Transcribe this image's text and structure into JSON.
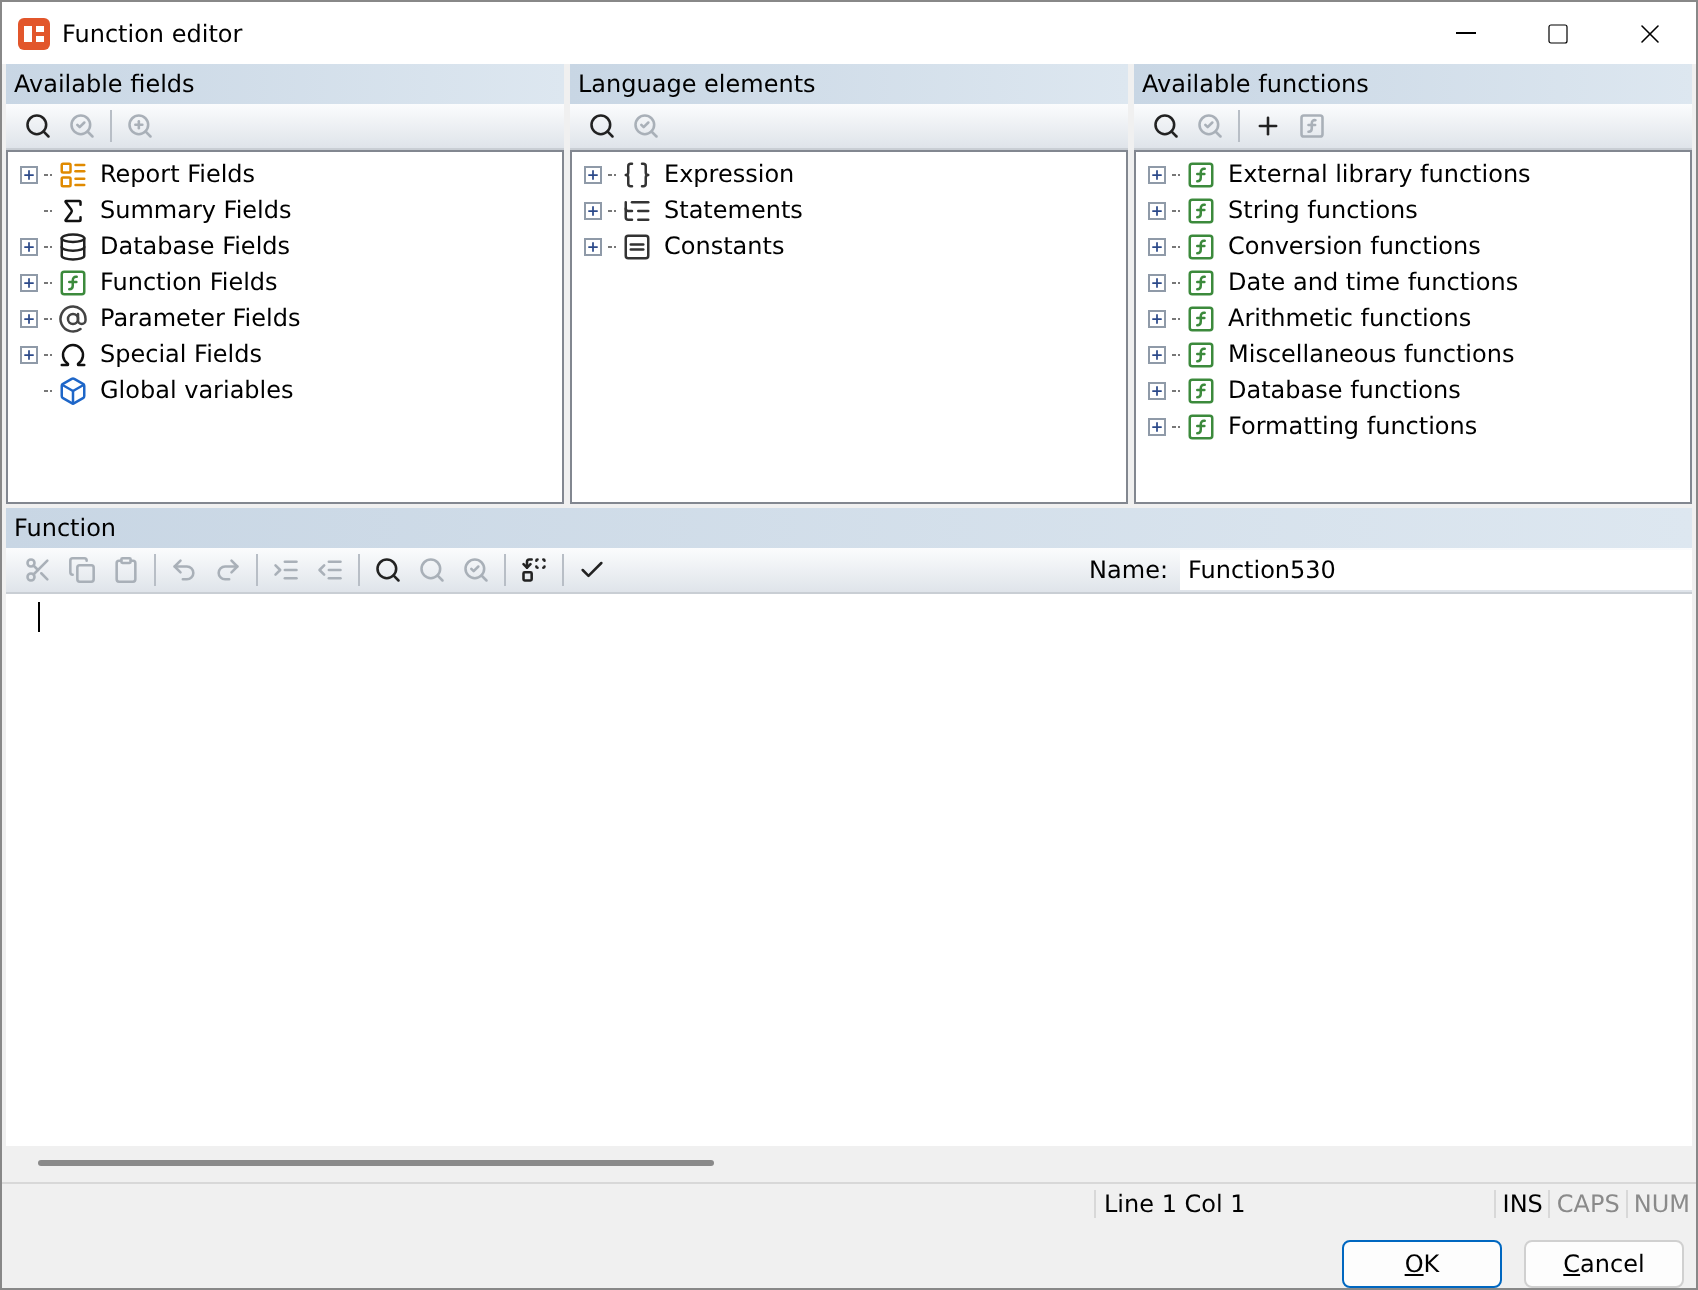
{
  "window": {
    "title": "Function editor"
  },
  "panels": [
    {
      "title": "Available fields",
      "tools": [
        {
          "kind": "search",
          "disabled": false
        },
        {
          "kind": "search-next",
          "disabled": true
        },
        {
          "kind": "sep"
        },
        {
          "kind": "zoom",
          "disabled": true
        }
      ],
      "items": [
        {
          "label": "Report Fields",
          "kind": "report",
          "expandable": true
        },
        {
          "label": "Summary Fields",
          "kind": "sum",
          "expandable": false
        },
        {
          "label": "Database Fields",
          "kind": "database",
          "expandable": true
        },
        {
          "label": "Function Fields",
          "kind": "function",
          "expandable": true
        },
        {
          "label": "Parameter Fields",
          "kind": "parameter",
          "expandable": true
        },
        {
          "label": "Special Fields",
          "kind": "special",
          "expandable": true
        },
        {
          "label": "Global variables",
          "kind": "global",
          "expandable": false
        }
      ]
    },
    {
      "title": "Language elements",
      "tools": [
        {
          "kind": "search",
          "disabled": false
        },
        {
          "kind": "search-next",
          "disabled": true
        }
      ],
      "items": [
        {
          "label": "Expression",
          "kind": "expression",
          "expandable": true
        },
        {
          "label": "Statements",
          "kind": "statements",
          "expandable": true
        },
        {
          "label": "Constants",
          "kind": "constants",
          "expandable": true
        }
      ]
    },
    {
      "title": "Available functions",
      "tools": [
        {
          "kind": "search",
          "disabled": false
        },
        {
          "kind": "search-next",
          "disabled": true
        },
        {
          "kind": "sep"
        },
        {
          "kind": "add-function",
          "disabled": false
        },
        {
          "kind": "remove-function",
          "disabled": true
        }
      ],
      "items": [
        {
          "label": "External library functions",
          "kind": "function",
          "expandable": true
        },
        {
          "label": "String functions",
          "kind": "function",
          "expandable": true
        },
        {
          "label": "Conversion functions",
          "kind": "function",
          "expandable": true
        },
        {
          "label": "Date and time functions",
          "kind": "function",
          "expandable": true
        },
        {
          "label": "Arithmetic functions",
          "kind": "function",
          "expandable": true
        },
        {
          "label": "Miscellaneous functions",
          "kind": "function",
          "expandable": true
        },
        {
          "label": "Database functions",
          "kind": "function",
          "expandable": true
        },
        {
          "label": "Formatting functions",
          "kind": "function",
          "expandable": true
        }
      ]
    }
  ],
  "editor": {
    "title": "Function",
    "tools": [
      {
        "kind": "cut",
        "disabled": true
      },
      {
        "kind": "copy",
        "disabled": true
      },
      {
        "kind": "paste",
        "disabled": true
      },
      {
        "kind": "sep"
      },
      {
        "kind": "undo",
        "disabled": true
      },
      {
        "kind": "redo",
        "disabled": true
      },
      {
        "kind": "sep"
      },
      {
        "kind": "indent",
        "disabled": true
      },
      {
        "kind": "outdent",
        "disabled": true
      },
      {
        "kind": "sep"
      },
      {
        "kind": "search",
        "disabled": false
      },
      {
        "kind": "search-prev",
        "disabled": true
      },
      {
        "kind": "search-next",
        "disabled": true
      },
      {
        "kind": "sep"
      },
      {
        "kind": "replace",
        "disabled": false
      },
      {
        "kind": "sep"
      },
      {
        "kind": "check-function",
        "disabled": false
      }
    ],
    "name_label": "Name:",
    "name_value": "Function530"
  },
  "status_bar": {
    "position": "Line 1 Col 1",
    "indicators": [
      {
        "label": "INS",
        "active": true
      },
      {
        "label": "CAPS",
        "active": false
      },
      {
        "label": "NUM",
        "active": false
      }
    ]
  },
  "buttons": [
    {
      "label": "OK",
      "default": true
    },
    {
      "label": "Cancel",
      "default": false
    }
  ]
}
